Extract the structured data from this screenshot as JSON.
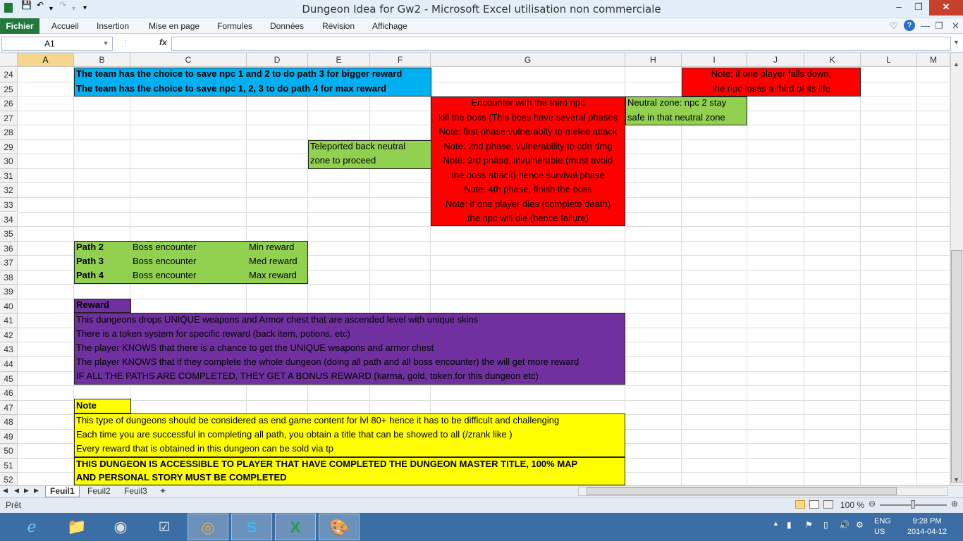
{
  "window": {
    "title": "Dungeon Idea for Gw2  -  Microsoft Excel utilisation non commerciale",
    "minimize": "–",
    "restore": "❐",
    "close": "✕"
  },
  "quick_access": {
    "save_icon": "save-icon",
    "undo_icon": "undo-icon",
    "redo_icon": "redo-icon"
  },
  "ribbon": {
    "tabs": [
      "Fichier",
      "Accueil",
      "Insertion",
      "Mise en page",
      "Formules",
      "Données",
      "Révision",
      "Affichage"
    ],
    "help": "?"
  },
  "formula_bar": {
    "name_box": "A1",
    "fx": "fx",
    "value": ""
  },
  "columns": [
    "A",
    "B",
    "C",
    "D",
    "E",
    "F",
    "G",
    "H",
    "I",
    "J",
    "K",
    "L",
    "M"
  ],
  "selected_column": "A",
  "rows": [
    "24",
    "25",
    "26",
    "27",
    "28",
    "29",
    "30",
    "31",
    "32",
    "33",
    "34",
    "35",
    "36",
    "37",
    "38",
    "39",
    "40",
    "41",
    "42",
    "43",
    "44",
    "45",
    "46",
    "47",
    "48",
    "49",
    "50",
    "51",
    "52"
  ],
  "cells": {
    "b24": "The team has the choice to save npc 1 and 2 to do path 3 for bigger reward",
    "b25": "The team has the choice to save npc 1, 2, 3 to do path 4 for max reward",
    "i24": "Note: if one player falls down,",
    "i25": "the npc loses a third of its life",
    "g26": "Encounter with the third npc",
    "g27": "kill the boss (This boss have several phases",
    "g28": "Note: first phase vulnerabity to melee attack",
    "g29": "Note: 2nd phase, vulnerability to cdn dmg",
    "g30": "Note: 3rd phase, invulnerable (must avoid",
    "g31": "the boss attack) hence survival phase",
    "g32": "Note: 4th phase, finish the boss",
    "g33": "Note: if one player dies (complete death)",
    "g34": "the npc will die (hence failure)",
    "h26": "Neutral zone: npc 2 stay",
    "h27": "safe in that neutral zone",
    "e29": "Teleported back neutral",
    "e30": "zone to proceed",
    "paths": [
      {
        "path": "Path 2",
        "encounter": "Boss encounter",
        "reward": "Min reward"
      },
      {
        "path": "Path 3",
        "encounter": "Boss encounter",
        "reward": "Med reward"
      },
      {
        "path": "Path 4",
        "encounter": "Boss encounter",
        "reward": "Max reward"
      }
    ],
    "reward_title": "Reward",
    "reward_lines": [
      "This dungeons drops UNIQUE weapons and Armor chest that are ascended level with unique skins",
      "There is a token system for specific reward (back item, potions, etc)",
      "The player KNOWS that there is a chance to get the UNIQUE weapons and armor chest",
      "The player KNOWS that if they complete the whole dungeon (doing all path and all boss encounter) the will get more reward",
      "IF ALL THE PATHS ARE COMPLETED, THEY GET A BONUS REWARD (karma, gold, token for this dungeon etc)"
    ],
    "note_title": "Note",
    "note_lines": [
      "This type of dungeons should be considered as end game content for lvl 80+ hence it has to be difficult and challenging",
      "Each time you are successful in completing all path, you obtain a title that can be showed to all (/zrank like )",
      "Every reward that is obtained in this dungeon can be sold via tp"
    ],
    "note_bold_lines": [
      "THIS DUNGEON IS ACCESSIBLE TO PLAYER THAT HAVE COMPLETED THE DUNGEON MASTER TITLE, 100% MAP",
      "AND PERSONAL STORY MUST BE COMPLETED"
    ]
  },
  "colors": {
    "blue": "#00b0f0",
    "red": "#ff0000",
    "green": "#92d050",
    "purple": "#7030a0",
    "yellow": "#ffff00"
  },
  "sheets": [
    "Feuil1",
    "Feuil2",
    "Feuil3"
  ],
  "status": {
    "ready": "Prêt",
    "zoom": "100 %"
  },
  "taskbar": {
    "apps": [
      "ie-icon",
      "explorer-icon",
      "media-icon",
      "help-icon",
      "chrome-icon",
      "skype-icon",
      "excel-icon",
      "paint-icon"
    ],
    "lang1": "ENG",
    "lang2": "US",
    "time": "9:28 PM",
    "date": "2014-04-12"
  }
}
